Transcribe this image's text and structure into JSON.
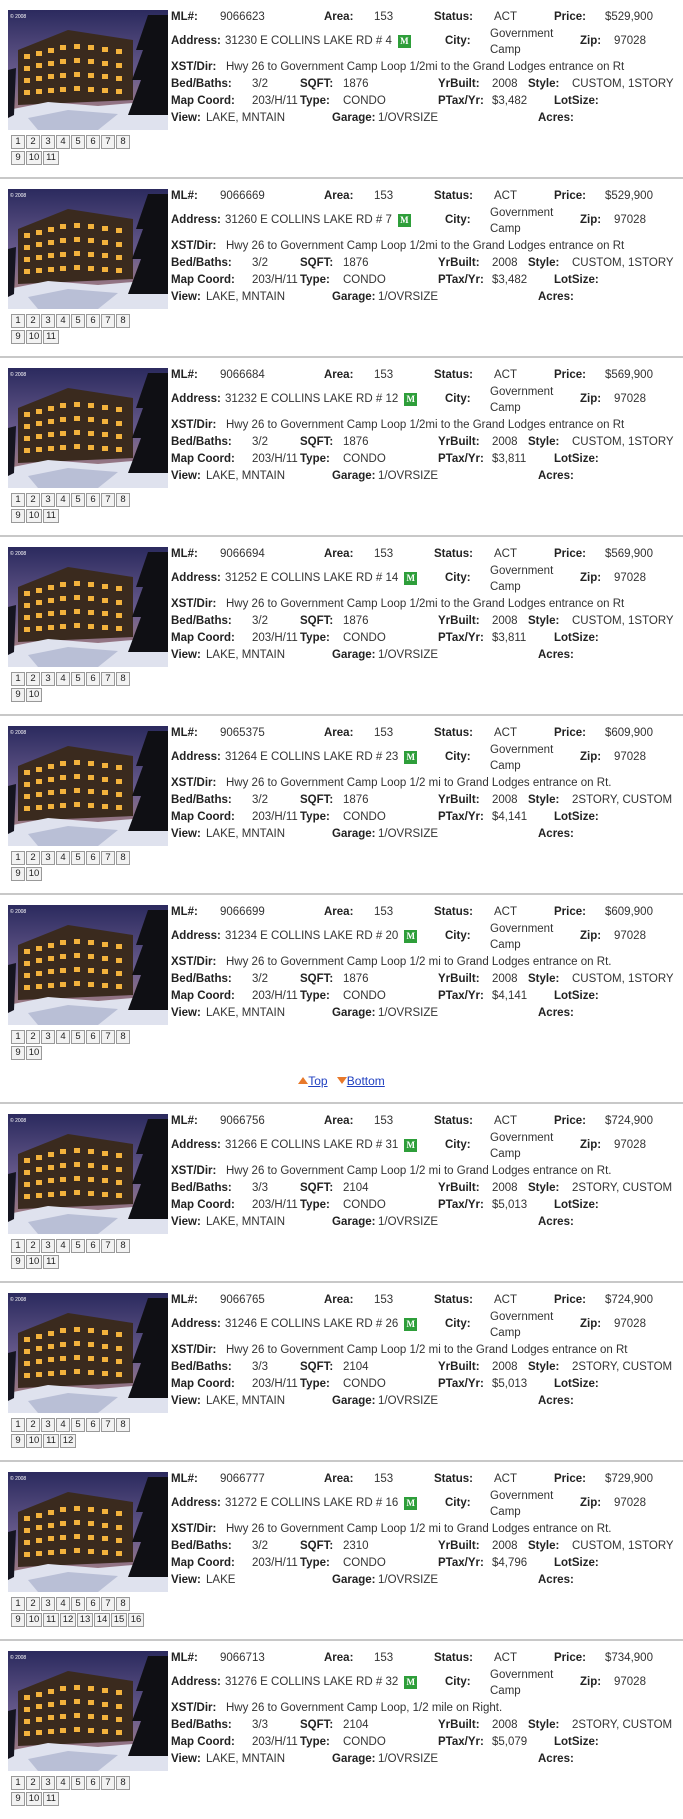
{
  "labels": {
    "ml": "ML#:",
    "area": "Area:",
    "status": "Status:",
    "price": "Price:",
    "address": "Address:",
    "city": "City:",
    "zip": "Zip:",
    "xst": "XST/Dir:",
    "bedbaths": "Bed/Baths:",
    "sqft": "SQFT:",
    "yrbuilt": "YrBuilt:",
    "style": "Style:",
    "mapcoord": "Map Coord:",
    "type": "Type:",
    "ptax": "PTax/Yr:",
    "lotsize": "LotSize:",
    "view": "View:",
    "garage": "Garage:",
    "acres": "Acres:"
  },
  "badge_label": "M",
  "photo_watermark": "© 2008",
  "nav": {
    "top_label": "Top",
    "bottom_label": "Bottom",
    "arrow_color": "#e8792a",
    "link_color": "#2040c0"
  },
  "listings": [
    {
      "ml": "9066623",
      "area": "153",
      "status": "ACT",
      "price": "$529,900",
      "address": "31230 E COLLINS LAKE RD # 4",
      "city": "Government Camp",
      "zip": "97028",
      "xst": "Hwy 26 to Government Camp Loop 1/2mi to the Grand Lodges entrance on Rt",
      "bedbaths": "3/2",
      "sqft": "1876",
      "yrbuilt": "2008",
      "style": "CUSTOM, 1STORY",
      "mapcoord": "203/H/11",
      "type": "CONDO",
      "ptax": "$3,482",
      "lotsize": "",
      "view": "LAKE, MNTAIN",
      "garage": "1/OVRSIZE",
      "acres": "",
      "photos": [
        "1",
        "2",
        "3",
        "4",
        "5",
        "6",
        "7",
        "8",
        "9",
        "10",
        "11"
      ]
    },
    {
      "ml": "9066669",
      "area": "153",
      "status": "ACT",
      "price": "$529,900",
      "address": "31260 E COLLINS LAKE RD # 7",
      "city": "Government Camp",
      "zip": "97028",
      "xst": "Hwy 26 to Government Camp Loop 1/2mi to the Grand Lodges entrance on Rt",
      "bedbaths": "3/2",
      "sqft": "1876",
      "yrbuilt": "2008",
      "style": "CUSTOM, 1STORY",
      "mapcoord": "203/H/11",
      "type": "CONDO",
      "ptax": "$3,482",
      "lotsize": "",
      "view": "LAKE, MNTAIN",
      "garage": "1/OVRSIZE",
      "acres": "",
      "photos": [
        "1",
        "2",
        "3",
        "4",
        "5",
        "6",
        "7",
        "8",
        "9",
        "10",
        "11"
      ]
    },
    {
      "ml": "9066684",
      "area": "153",
      "status": "ACT",
      "price": "$569,900",
      "address": "31232 E COLLINS LAKE RD # 12",
      "city": "Government Camp",
      "zip": "97028",
      "xst": "Hwy 26 to Government Camp Loop 1/2mi to the Grand Lodges entrance on Rt",
      "bedbaths": "3/2",
      "sqft": "1876",
      "yrbuilt": "2008",
      "style": "CUSTOM, 1STORY",
      "mapcoord": "203/H/11",
      "type": "CONDO",
      "ptax": "$3,811",
      "lotsize": "",
      "view": "LAKE, MNTAIN",
      "garage": "1/OVRSIZE",
      "acres": "",
      "photos": [
        "1",
        "2",
        "3",
        "4",
        "5",
        "6",
        "7",
        "8",
        "9",
        "10",
        "11"
      ]
    },
    {
      "ml": "9066694",
      "area": "153",
      "status": "ACT",
      "price": "$569,900",
      "address": "31252 E COLLINS LAKE RD # 14",
      "city": "Government Camp",
      "zip": "97028",
      "xst": "Hwy 26 to Government Camp Loop 1/2mi to the Grand Lodges entrance on Rt",
      "bedbaths": "3/2",
      "sqft": "1876",
      "yrbuilt": "2008",
      "style": "CUSTOM, 1STORY",
      "mapcoord": "203/H/11",
      "type": "CONDO",
      "ptax": "$3,811",
      "lotsize": "",
      "view": "LAKE, MNTAIN",
      "garage": "1/OVRSIZE",
      "acres": "",
      "photos": [
        "1",
        "2",
        "3",
        "4",
        "5",
        "6",
        "7",
        "8",
        "9",
        "10"
      ]
    },
    {
      "ml": "9065375",
      "area": "153",
      "status": "ACT",
      "price": "$609,900",
      "address": "31264 E COLLINS LAKE RD # 23",
      "city": "Government Camp",
      "zip": "97028",
      "xst": "Hwy 26 to Government Camp Loop 1/2 mi to Grand Lodges entrance on Rt.",
      "bedbaths": "3/2",
      "sqft": "1876",
      "yrbuilt": "2008",
      "style": "2STORY, CUSTOM",
      "mapcoord": "203/H/11",
      "type": "CONDO",
      "ptax": "$4,141",
      "lotsize": "",
      "view": "LAKE, MNTAIN",
      "garage": "1/OVRSIZE",
      "acres": "",
      "photos": [
        "1",
        "2",
        "3",
        "4",
        "5",
        "6",
        "7",
        "8",
        "9",
        "10"
      ]
    },
    {
      "ml": "9066699",
      "area": "153",
      "status": "ACT",
      "price": "$609,900",
      "address": "31234 E COLLINS LAKE RD # 20",
      "city": "Government Camp",
      "zip": "97028",
      "xst": "Hwy 26 to Government Camp Loop 1/2 mi to Grand Lodges entrance on Rt.",
      "bedbaths": "3/2",
      "sqft": "1876",
      "yrbuilt": "2008",
      "style": "CUSTOM, 1STORY",
      "mapcoord": "203/H/11",
      "type": "CONDO",
      "ptax": "$4,141",
      "lotsize": "",
      "view": "LAKE, MNTAIN",
      "garage": "1/OVRSIZE",
      "acres": "",
      "photos": [
        "1",
        "2",
        "3",
        "4",
        "5",
        "6",
        "7",
        "8",
        "9",
        "10"
      ]
    },
    {
      "ml": "9066756",
      "area": "153",
      "status": "ACT",
      "price": "$724,900",
      "address": "31266 E COLLINS LAKE RD # 31",
      "city": "Government Camp",
      "zip": "97028",
      "xst": "Hwy 26 to Government Camp Loop 1/2 mi to Grand Lodges entrance on Rt.",
      "bedbaths": "3/3",
      "sqft": "2104",
      "yrbuilt": "2008",
      "style": "2STORY, CUSTOM",
      "mapcoord": "203/H/11",
      "type": "CONDO",
      "ptax": "$5,013",
      "lotsize": "",
      "view": "LAKE, MNTAIN",
      "garage": "1/OVRSIZE",
      "acres": "",
      "photos": [
        "1",
        "2",
        "3",
        "4",
        "5",
        "6",
        "7",
        "8",
        "9",
        "10",
        "11"
      ]
    },
    {
      "ml": "9066765",
      "area": "153",
      "status": "ACT",
      "price": "$724,900",
      "address": "31246 E COLLINS LAKE RD # 26",
      "city": "Government Camp",
      "zip": "97028",
      "xst": "Hwy 26 to Government Camp Loop 1/2 mi to the Grand Lodges entrance on Rt",
      "bedbaths": "3/3",
      "sqft": "2104",
      "yrbuilt": "2008",
      "style": "2STORY, CUSTOM",
      "mapcoord": "203/H/11",
      "type": "CONDO",
      "ptax": "$5,013",
      "lotsize": "",
      "view": "LAKE, MNTAIN",
      "garage": "1/OVRSIZE",
      "acres": "",
      "photos": [
        "1",
        "2",
        "3",
        "4",
        "5",
        "6",
        "7",
        "8",
        "9",
        "10",
        "11",
        "12"
      ]
    },
    {
      "ml": "9066777",
      "area": "153",
      "status": "ACT",
      "price": "$729,900",
      "address": "31272 E COLLINS LAKE RD # 16",
      "city": "Government Camp",
      "zip": "97028",
      "xst": "Hwy 26 to Government Camp Loop 1/2 mi to Grand Lodges entrance on Rt.",
      "bedbaths": "3/2",
      "sqft": "2310",
      "yrbuilt": "2008",
      "style": "CUSTOM, 1STORY",
      "mapcoord": "203/H/11",
      "type": "CONDO",
      "ptax": "$4,796",
      "lotsize": "",
      "view": "LAKE",
      "garage": "1/OVRSIZE",
      "acres": "",
      "photos": [
        "1",
        "2",
        "3",
        "4",
        "5",
        "6",
        "7",
        "8",
        "9",
        "10",
        "11",
        "12",
        "13",
        "14",
        "15",
        "16"
      ]
    },
    {
      "ml": "9066713",
      "area": "153",
      "status": "ACT",
      "price": "$734,900",
      "address": "31276 E COLLINS LAKE RD # 32",
      "city": "Government Camp",
      "zip": "97028",
      "xst": "Hwy 26 to Government Camp Loop, 1/2 mile on Right.",
      "bedbaths": "3/3",
      "sqft": "2104",
      "yrbuilt": "2008",
      "style": "2STORY, CUSTOM",
      "mapcoord": "203/H/11",
      "type": "CONDO",
      "ptax": "$5,079",
      "lotsize": "",
      "view": "LAKE, MNTAIN",
      "garage": "1/OVRSIZE",
      "acres": "",
      "photos": [
        "1",
        "2",
        "3",
        "4",
        "5",
        "6",
        "7",
        "8",
        "9",
        "10",
        "11"
      ]
    }
  ]
}
